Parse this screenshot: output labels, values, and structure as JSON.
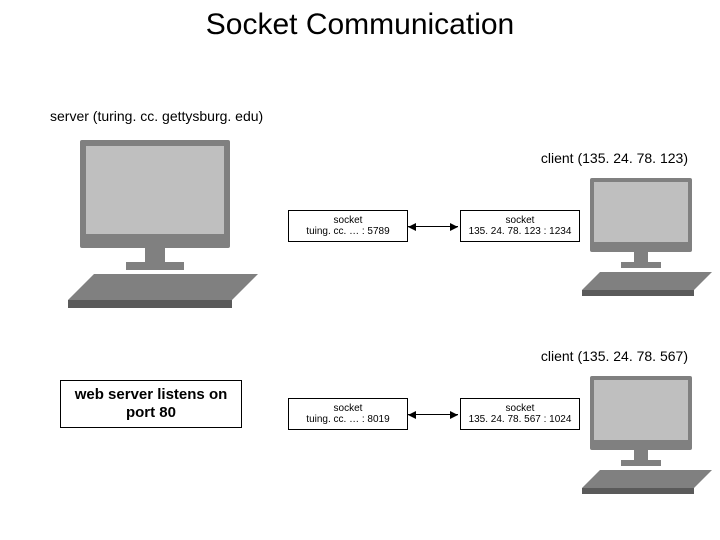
{
  "title": "Socket Communication",
  "server_label": "server (turing. cc. gettysburg. edu)",
  "client1_label": "client (135. 24. 78. 123)",
  "client2_label": "client (135. 24. 78. 567)",
  "port80_text": "web server listens on port 80",
  "sockets": {
    "s1": {
      "top": "socket",
      "bottom": "tuing. cc. … : 5789"
    },
    "s2": {
      "top": "socket",
      "bottom": "135. 24. 78. 123 : 1234"
    },
    "s3": {
      "top": "socket",
      "bottom": "tuing. cc. … : 8019"
    },
    "s4": {
      "top": "socket",
      "bottom": "135. 24. 78. 567 : 1024"
    }
  }
}
